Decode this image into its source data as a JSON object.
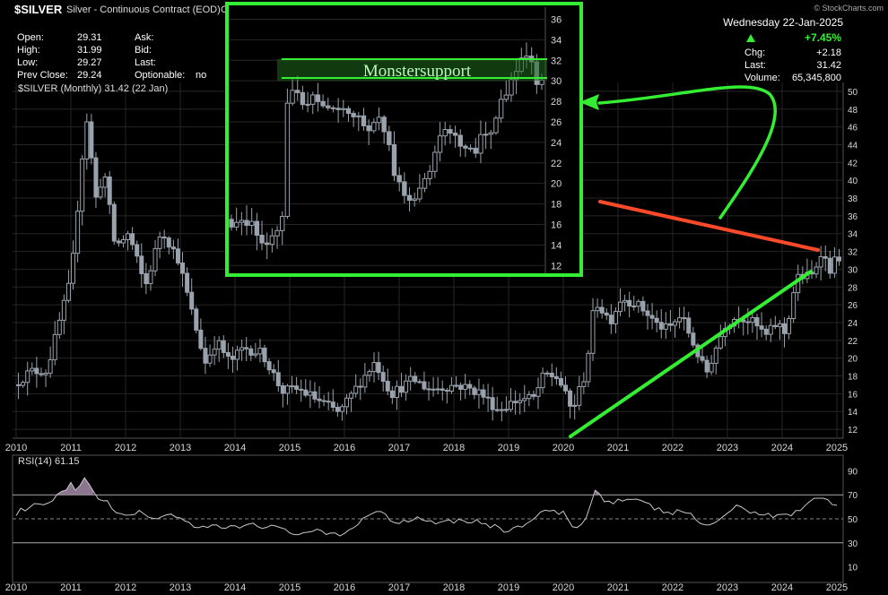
{
  "header": {
    "symbol": "$SILVER",
    "description": "Silver - Continuous Contract (EOD)",
    "exchange": "CE",
    "watermark": "© StockCharts.com",
    "date_line": "Wednesday  22-Jan-2025",
    "pct_change": "+7.45%",
    "fields": [
      {
        "label": "Open:",
        "value": "29.31"
      },
      {
        "label": "High:",
        "value": "31.99"
      },
      {
        "label": "Low:",
        "value": "29.27"
      },
      {
        "label": "Prev Close:",
        "value": "29.24"
      }
    ],
    "mid_fields": [
      {
        "label": "Ask:",
        "value": ""
      },
      {
        "label": "Bid:",
        "value": ""
      },
      {
        "label": "Last:",
        "value": ""
      },
      {
        "label": "Optionable:",
        "value": "no"
      }
    ],
    "right_fields": [
      {
        "label": "Chg:",
        "value": "+2.18"
      },
      {
        "label": "Last:",
        "value": "31.42"
      },
      {
        "label": "Volume:",
        "value": "65,345,800"
      }
    ]
  },
  "colors": {
    "background": "#000000",
    "candle": "#9aa3ad",
    "grid": "#262626",
    "axis_text": "#d8d8d8",
    "green_accent": "#33ee33",
    "red_line": "#ff4a2a",
    "rsi_line": "#c8c8c8",
    "rsi_fill": "#a48aa8"
  },
  "chart_data": [
    {
      "type": "candlestick",
      "legend": "$SILVER (Monthly) 31.42 (22 Jan)",
      "ylim": [
        11,
        51
      ],
      "y_ticks": [
        12,
        14,
        16,
        18,
        20,
        22,
        24,
        26,
        28,
        30,
        32,
        34,
        36,
        38,
        40,
        42,
        44,
        46,
        48,
        50
      ],
      "x_ticks": [
        "2010",
        "2011",
        "2012",
        "2013",
        "2014",
        "2015",
        "2016",
        "2017",
        "2018",
        "2019",
        "2020",
        "2021",
        "2022",
        "2023",
        "2024",
        "2025"
      ],
      "x_range": [
        2010.0,
        2025.05
      ],
      "close_anchors": [
        [
          2010.0,
          17.0
        ],
        [
          2010.3,
          18.5
        ],
        [
          2010.6,
          18.6
        ],
        [
          2010.85,
          24.5
        ],
        [
          2011.05,
          29
        ],
        [
          2011.32,
          47.5
        ],
        [
          2011.5,
          38
        ],
        [
          2011.65,
          41
        ],
        [
          2011.85,
          32.5
        ],
        [
          2012.1,
          34
        ],
        [
          2012.4,
          28
        ],
        [
          2012.7,
          34.5
        ],
        [
          2013.0,
          31.2
        ],
        [
          2013.3,
          24
        ],
        [
          2013.5,
          19.5
        ],
        [
          2013.7,
          22
        ],
        [
          2013.95,
          19.5
        ],
        [
          2014.2,
          21.2
        ],
        [
          2014.55,
          20.5
        ],
        [
          2014.9,
          16.3
        ],
        [
          2015.2,
          16.5
        ],
        [
          2015.5,
          15.5
        ],
        [
          2015.95,
          13.8
        ],
        [
          2016.35,
          17.5
        ],
        [
          2016.6,
          19.6
        ],
        [
          2016.9,
          16
        ],
        [
          2017.3,
          17.6
        ],
        [
          2017.6,
          16.5
        ],
        [
          2018.1,
          17
        ],
        [
          2018.5,
          16.2
        ],
        [
          2018.85,
          14.2
        ],
        [
          2019.2,
          15.3
        ],
        [
          2019.5,
          15.5
        ],
        [
          2019.7,
          18.2
        ],
        [
          2019.95,
          17.8
        ],
        [
          2020.2,
          14.0
        ],
        [
          2020.45,
          18.4
        ],
        [
          2020.62,
          26.5
        ],
        [
          2020.9,
          24.2
        ],
        [
          2021.1,
          26.8
        ],
        [
          2021.35,
          26.2
        ],
        [
          2021.55,
          25.2
        ],
        [
          2021.75,
          23.8
        ],
        [
          2021.95,
          23.2
        ],
        [
          2022.2,
          24.8
        ],
        [
          2022.45,
          21.2
        ],
        [
          2022.65,
          18.2
        ],
        [
          2022.85,
          21.5
        ],
        [
          2023.0,
          23.8
        ],
        [
          2023.25,
          24.8
        ],
        [
          2023.5,
          24.0
        ],
        [
          2023.75,
          22.5
        ],
        [
          2023.95,
          24.0
        ],
        [
          2024.1,
          22.7
        ],
        [
          2024.3,
          29.0
        ],
        [
          2024.45,
          29.2
        ],
        [
          2024.6,
          29.3
        ],
        [
          2024.75,
          32.0
        ],
        [
          2024.92,
          30.0
        ],
        [
          2025.05,
          31.42
        ]
      ],
      "ranges_note": ""
    },
    {
      "type": "candlestick-inset",
      "annotation": "Monstersupport",
      "ylim": [
        11.5,
        37
      ],
      "y_ticks": [
        12,
        14,
        16,
        18,
        20,
        22,
        24,
        26,
        28,
        30,
        32,
        34,
        36
      ],
      "support_level": 30,
      "close_anchors": [
        [
          0,
          16.5
        ],
        [
          0.08,
          16.2
        ],
        [
          0.12,
          13.2
        ],
        [
          0.18,
          17
        ],
        [
          0.2,
          29.5
        ],
        [
          0.25,
          27.5
        ],
        [
          0.3,
          28.5
        ],
        [
          0.35,
          26.5
        ],
        [
          0.4,
          27.2
        ],
        [
          0.45,
          25
        ],
        [
          0.5,
          26.5
        ],
        [
          0.55,
          20
        ],
        [
          0.6,
          18.5
        ],
        [
          0.65,
          21
        ],
        [
          0.7,
          25
        ],
        [
          0.75,
          24
        ],
        [
          0.8,
          23.5
        ],
        [
          0.85,
          25.2
        ],
        [
          0.9,
          28.5
        ],
        [
          0.93,
          31
        ],
        [
          0.96,
          33.5
        ],
        [
          1.0,
          29.5
        ]
      ]
    },
    {
      "type": "line",
      "legend": "RSI(14) 61.15",
      "ylim": [
        0,
        100
      ],
      "y_ticks": [
        10,
        30,
        50,
        70,
        90
      ],
      "levels": [
        30,
        50,
        70
      ],
      "x_ticks": [
        "2010",
        "2011",
        "2012",
        "2013",
        "2014",
        "2015",
        "2016",
        "2017",
        "2018",
        "2019",
        "2020",
        "2021",
        "2022",
        "2023",
        "2024",
        "2025"
      ],
      "anchors": [
        [
          2010.0,
          55
        ],
        [
          2010.3,
          60
        ],
        [
          2010.6,
          62
        ],
        [
          2010.85,
          72
        ],
        [
          2011.0,
          78
        ],
        [
          2011.1,
          72
        ],
        [
          2011.3,
          85
        ],
        [
          2011.45,
          68
        ],
        [
          2011.7,
          62
        ],
        [
          2011.9,
          52
        ],
        [
          2012.2,
          56
        ],
        [
          2012.5,
          50
        ],
        [
          2012.8,
          55
        ],
        [
          2013.0,
          50
        ],
        [
          2013.3,
          40
        ],
        [
          2013.6,
          44
        ],
        [
          2013.95,
          42
        ],
        [
          2014.3,
          46
        ],
        [
          2014.7,
          43
        ],
        [
          2015.0,
          38
        ],
        [
          2015.4,
          40
        ],
        [
          2015.9,
          35
        ],
        [
          2016.4,
          52
        ],
        [
          2016.6,
          58
        ],
        [
          2016.9,
          47
        ],
        [
          2017.3,
          51
        ],
        [
          2017.7,
          48
        ],
        [
          2018.2,
          49
        ],
        [
          2018.6,
          46
        ],
        [
          2018.9,
          40
        ],
        [
          2019.3,
          45
        ],
        [
          2019.7,
          57
        ],
        [
          2020.0,
          54
        ],
        [
          2020.2,
          40
        ],
        [
          2020.45,
          55
        ],
        [
          2020.6,
          75
        ],
        [
          2020.8,
          64
        ],
        [
          2021.1,
          66
        ],
        [
          2021.4,
          64
        ],
        [
          2021.7,
          58
        ],
        [
          2022.0,
          55
        ],
        [
          2022.3,
          56
        ],
        [
          2022.6,
          42
        ],
        [
          2022.9,
          52
        ],
        [
          2023.2,
          60
        ],
        [
          2023.5,
          56
        ],
        [
          2023.8,
          52
        ],
        [
          2024.0,
          55
        ],
        [
          2024.2,
          52
        ],
        [
          2024.4,
          63
        ],
        [
          2024.6,
          66
        ],
        [
          2024.8,
          70
        ],
        [
          2024.95,
          60
        ],
        [
          2025.05,
          61
        ]
      ]
    }
  ]
}
